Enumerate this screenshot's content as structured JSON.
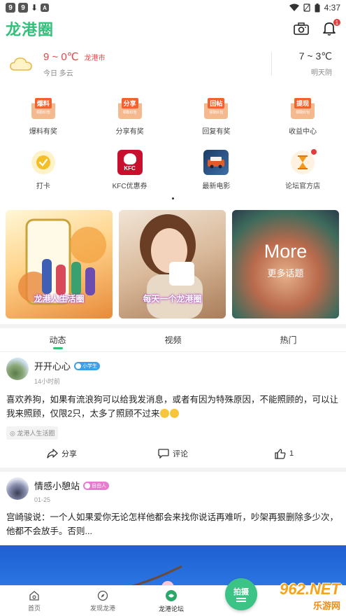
{
  "status_bar": {
    "badge1": "9",
    "badge2": "9",
    "badge3": "A",
    "time": "4:37"
  },
  "header": {
    "title": "龙港圈",
    "notification_count": "1"
  },
  "weather": {
    "today_temp": "9 ~ 0℃",
    "city": "龙港市",
    "today_desc": "今日 多云",
    "tomorrow_temp": "7 ~ 3℃",
    "tomorrow_desc": "明天阴"
  },
  "quick_grid": [
    {
      "label": "爆料有奖",
      "tag": "爆料",
      "sub": "领取红包"
    },
    {
      "label": "分享有奖",
      "tag": "分享",
      "sub": "领取红包"
    },
    {
      "label": "回复有奖",
      "tag": "回帖",
      "sub": "领取红包"
    },
    {
      "label": "收益中心",
      "tag": "提现",
      "sub": "领取红包"
    },
    {
      "label": "打卡"
    },
    {
      "label": "KFC优惠券",
      "kfc_text": "KFC"
    },
    {
      "label": "最新电影"
    },
    {
      "label": "论坛官方店"
    }
  ],
  "topics": [
    {
      "caption": "龙港人生活圈"
    },
    {
      "caption": "每天一个龙港圈"
    },
    {
      "more_title": "More",
      "more_sub": "更多话题"
    }
  ],
  "tabs": [
    {
      "label": "动态",
      "active": true
    },
    {
      "label": "视频",
      "active": false
    },
    {
      "label": "热门",
      "active": false
    }
  ],
  "posts": [
    {
      "user": "开开心心",
      "badge": "小学生",
      "time": "14小时前",
      "text": "喜欢养狗，如果有流浪狗可以给我发消息，或者有因为特殊原因，不能照顾的，可以让我来照顾，仅限2只，太多了照顾不过来",
      "tag": "◎ 龙港人生活圈",
      "share": "分享",
      "comment": "评论",
      "likes": "1"
    },
    {
      "user": "情感小憩站",
      "badge": "自由人",
      "time": "01-25",
      "text": "宫崎骏说：一个人如果爱你无论怎样他都会来找你说话再难听，吵架再狠删除多少次，他都不会放手。否则..."
    }
  ],
  "bottom_nav": [
    {
      "label": "首页"
    },
    {
      "label": "发现龙港"
    },
    {
      "label": "龙港论坛"
    }
  ],
  "fab": {
    "label": "拍摄"
  },
  "watermark": {
    "main": "962.NET",
    "sub": "乐游网"
  },
  "colors": {
    "brand": "#33c07a",
    "accent_red": "#e54545",
    "badge_blue": "#3aa0e8",
    "badge_pink": "#e87ad0"
  }
}
